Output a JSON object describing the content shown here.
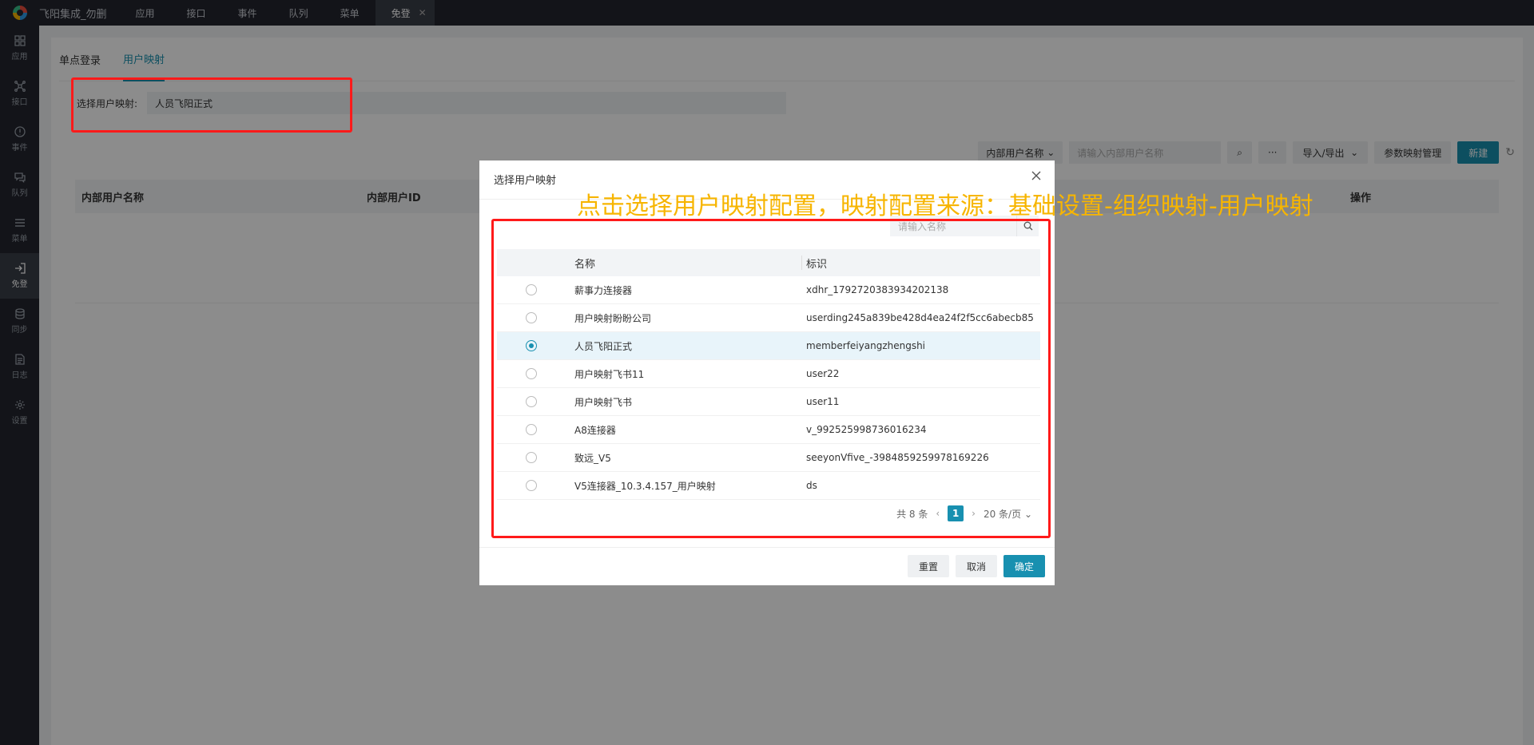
{
  "app": {
    "title": "飞阳集成_勿删"
  },
  "top_tabs": [
    {
      "label": "应用"
    },
    {
      "label": "接口"
    },
    {
      "label": "事件"
    },
    {
      "label": "队列"
    },
    {
      "label": "菜单"
    },
    {
      "label": "免登",
      "active": true
    }
  ],
  "sidebar": {
    "items": [
      {
        "label": "应用",
        "icon": "grid-icon"
      },
      {
        "label": "接口",
        "icon": "network-icon"
      },
      {
        "label": "事件",
        "icon": "alert-circle-icon"
      },
      {
        "label": "队列",
        "icon": "chat-icon"
      },
      {
        "label": "菜单",
        "icon": "menu-icon"
      },
      {
        "label": "免登",
        "icon": "login-icon",
        "active": true
      },
      {
        "label": "同步",
        "icon": "database-icon"
      },
      {
        "label": "日志",
        "icon": "document-icon"
      },
      {
        "label": "设置",
        "icon": "gear-icon"
      }
    ]
  },
  "subtabs": [
    {
      "label": "单点登录"
    },
    {
      "label": "用户映射",
      "active": true
    }
  ],
  "mapping_field": {
    "label": "选择用户映射:",
    "value": "人员飞阳正式"
  },
  "toolbar": {
    "filter_select": "内部用户名称",
    "search_placeholder": "请输入内部用户名称",
    "more": "···",
    "import_export": "导入/导出",
    "param_mapping": "参数映射管理",
    "new": "新建"
  },
  "table": {
    "headers": [
      "内部用户名称",
      "内部用户ID",
      "操作"
    ]
  },
  "modal": {
    "title": "选择用户映射",
    "search_placeholder": "请输入名称",
    "columns": [
      "名称",
      "标识"
    ],
    "rows": [
      {
        "name": "薪事力连接器",
        "id": "xdhr_1792720383934202138",
        "selected": false
      },
      {
        "name": "用户映射盼盼公司",
        "id": "userding245a839be428d4ea24f2f5cc6abecb85",
        "selected": false
      },
      {
        "name": "人员飞阳正式",
        "id": "memberfeiyangzhengshi",
        "selected": true
      },
      {
        "name": "用户映射飞书11",
        "id": "user22",
        "selected": false
      },
      {
        "name": "用户映射飞书",
        "id": "user11",
        "selected": false
      },
      {
        "name": "A8连接器",
        "id": "v_992525998736016234",
        "selected": false
      },
      {
        "name": "致远_V5",
        "id": "seeyonVfive_-3984859259978169226",
        "selected": false
      },
      {
        "name": "V5连接器_10.3.4.157_用户映射",
        "id": "ds",
        "selected": false
      }
    ],
    "pager": {
      "total": "共 8 条",
      "page": "1",
      "page_size": "20 条/页"
    },
    "buttons": {
      "reset": "重置",
      "cancel": "取消",
      "confirm": "确定"
    }
  },
  "annotation": {
    "text": "点击选择用户映射配置，映射配置来源：基础设置-组织映射-用户映射",
    "color": "#f7b500",
    "box_color": "#ff1a1a"
  }
}
